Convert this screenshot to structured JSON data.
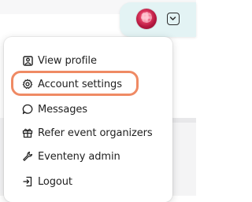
{
  "colors": {
    "pill_background": "#e3f3f4",
    "highlight": "#ef8a64",
    "text": "#1f1f1f"
  },
  "header": {
    "avatar_icon": "user-avatar",
    "dropdown_icon": "chevron-down-icon"
  },
  "menu": {
    "items": [
      {
        "label": "View profile",
        "icon": "user-profile-icon"
      },
      {
        "label": "Account settings",
        "icon": "gear-icon",
        "highlighted": true
      },
      {
        "label": "Messages",
        "icon": "chat-bubble-icon"
      },
      {
        "label": "Refer event organizers",
        "icon": "gift-icon"
      },
      {
        "label": "Eventeny admin",
        "icon": "wrench-icon"
      },
      {
        "label": "Logout",
        "icon": "logout-icon"
      }
    ]
  }
}
